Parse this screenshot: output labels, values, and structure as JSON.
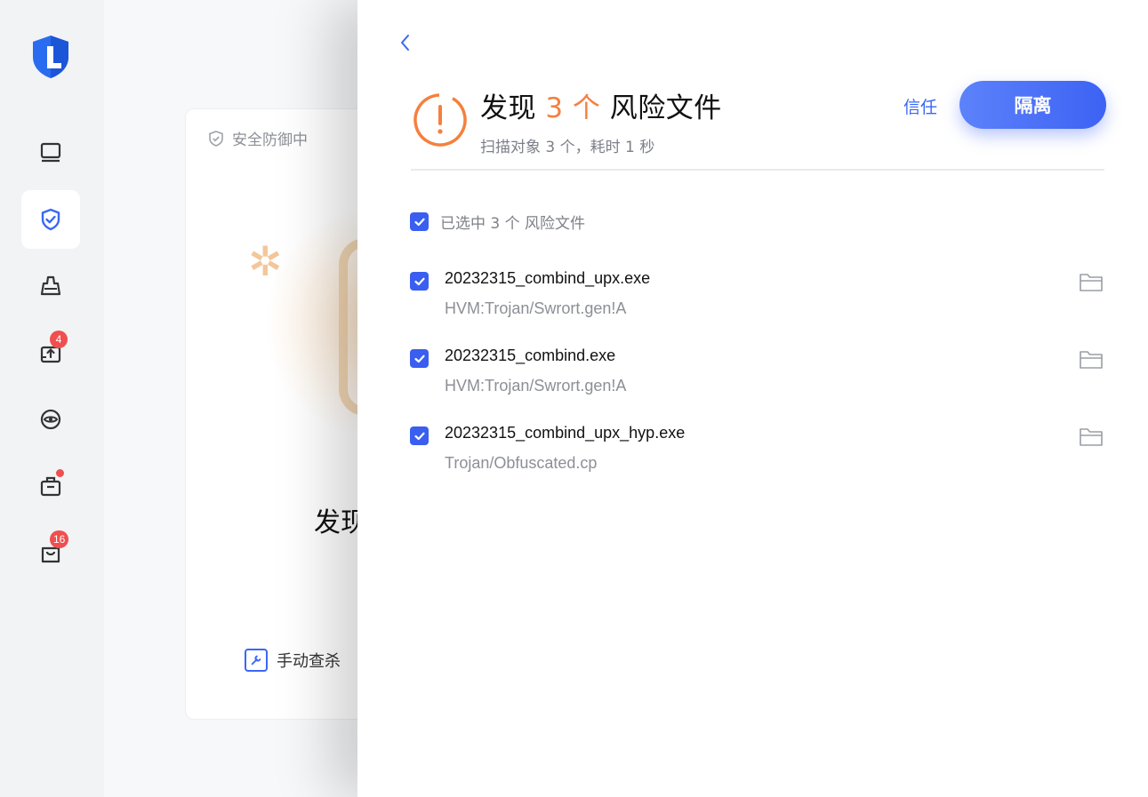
{
  "sidebar": {
    "items": [
      {
        "name": "computer",
        "icon": "monitor-icon"
      },
      {
        "name": "protection",
        "icon": "shield-check-icon",
        "active": true
      },
      {
        "name": "cleanup",
        "icon": "broom-icon"
      },
      {
        "name": "updates",
        "icon": "box-upload-icon",
        "badge": "4"
      },
      {
        "name": "privacy",
        "icon": "eye-icon"
      },
      {
        "name": "toolbox",
        "icon": "toolbox-icon",
        "dot": true
      },
      {
        "name": "messages",
        "icon": "bag-icon",
        "badge": "16"
      }
    ]
  },
  "background_card": {
    "status": "安全防御中",
    "headline": "发现",
    "manual_scan": "手动查杀"
  },
  "drawer": {
    "title_prefix": "发现",
    "title_count": "3 个",
    "title_suffix": "风险文件",
    "subtitle": "扫描对象 3 个，耗时 1 秒",
    "trust_label": "信任",
    "isolate_label": "隔离",
    "select_all_label": "已选中 3 个 风险文件",
    "files": [
      {
        "name": "20232315_combind_upx.exe",
        "threat": "HVM:Trojan/Swrort.gen!A"
      },
      {
        "name": "20232315_combind.exe",
        "threat": "HVM:Trojan/Swrort.gen!A"
      },
      {
        "name": "20232315_combind_upx_hyp.exe",
        "threat": "Trojan/Obfuscated.cp"
      }
    ]
  },
  "colors": {
    "accent": "#3a67f5",
    "warning": "#f5803e",
    "badge": "#f04f4f"
  }
}
